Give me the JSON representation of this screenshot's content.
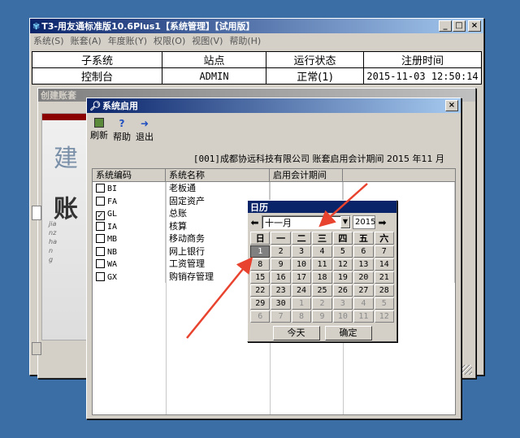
{
  "main": {
    "title": "T3-用友通标准版10.6Plus1【系统管理】【试用版】",
    "menu": [
      "系统(S)",
      "账套(A)",
      "年度账(Y)",
      "权限(O)",
      "视图(V)",
      "帮助(H)"
    ],
    "table_headers": [
      "子系统",
      "站点",
      "运行状态",
      "注册时间"
    ],
    "table_row": [
      "控制台",
      "ADMIN",
      "正常(1)",
      "2015-11-03 12:50:14"
    ],
    "min_glyph": "_",
    "max_glyph": "□",
    "close_glyph": "×"
  },
  "create": {
    "title": "创建账套",
    "banner_big1": "建",
    "banner_big2": "账",
    "banner_vert": "jianzhang"
  },
  "enable": {
    "title": "系统启用",
    "close_glyph": "×",
    "toolbar": {
      "refresh": "刷新",
      "help": "帮助",
      "exit": "退出"
    },
    "company_prefix": "[001]",
    "company_text": "成都协远科技有限公司 账套启用会计期间 2015 年11 月",
    "columns": [
      "系统编码",
      "系统名称",
      "启用会计期间",
      ""
    ],
    "rows": [
      {
        "code": "BI",
        "name": "老板通",
        "checked": false
      },
      {
        "code": "FA",
        "name": "固定资产",
        "checked": false
      },
      {
        "code": "GL",
        "name": "总账",
        "checked": true
      },
      {
        "code": "IA",
        "name": "核算",
        "checked": false
      },
      {
        "code": "MB",
        "name": "移动商务",
        "checked": false
      },
      {
        "code": "NB",
        "name": "网上银行",
        "checked": false
      },
      {
        "code": "WA",
        "name": "工资管理",
        "checked": false
      },
      {
        "code": "GX",
        "name": "购销存管理",
        "checked": false
      }
    ]
  },
  "calendar": {
    "title": "日历",
    "month": "十一月",
    "year": "2015",
    "weekdays": [
      "日",
      "一",
      "二",
      "三",
      "四",
      "五",
      "六"
    ],
    "days": [
      [
        "1",
        "2",
        "3",
        "4",
        "5",
        "6",
        "7"
      ],
      [
        "8",
        "9",
        "10",
        "11",
        "12",
        "13",
        "14"
      ],
      [
        "15",
        "16",
        "17",
        "18",
        "19",
        "20",
        "21"
      ],
      [
        "22",
        "23",
        "24",
        "25",
        "26",
        "27",
        "28"
      ],
      [
        "29",
        "30",
        "1",
        "2",
        "3",
        "4",
        "5"
      ],
      [
        "6",
        "7",
        "8",
        "9",
        "10",
        "11",
        "12"
      ]
    ],
    "selected_day": "1",
    "today_label": "今天",
    "ok_label": "确定"
  },
  "colors": {
    "desktop": "#3a6ea5",
    "title_active": "#0a246a",
    "arrow": "#e8432e"
  }
}
